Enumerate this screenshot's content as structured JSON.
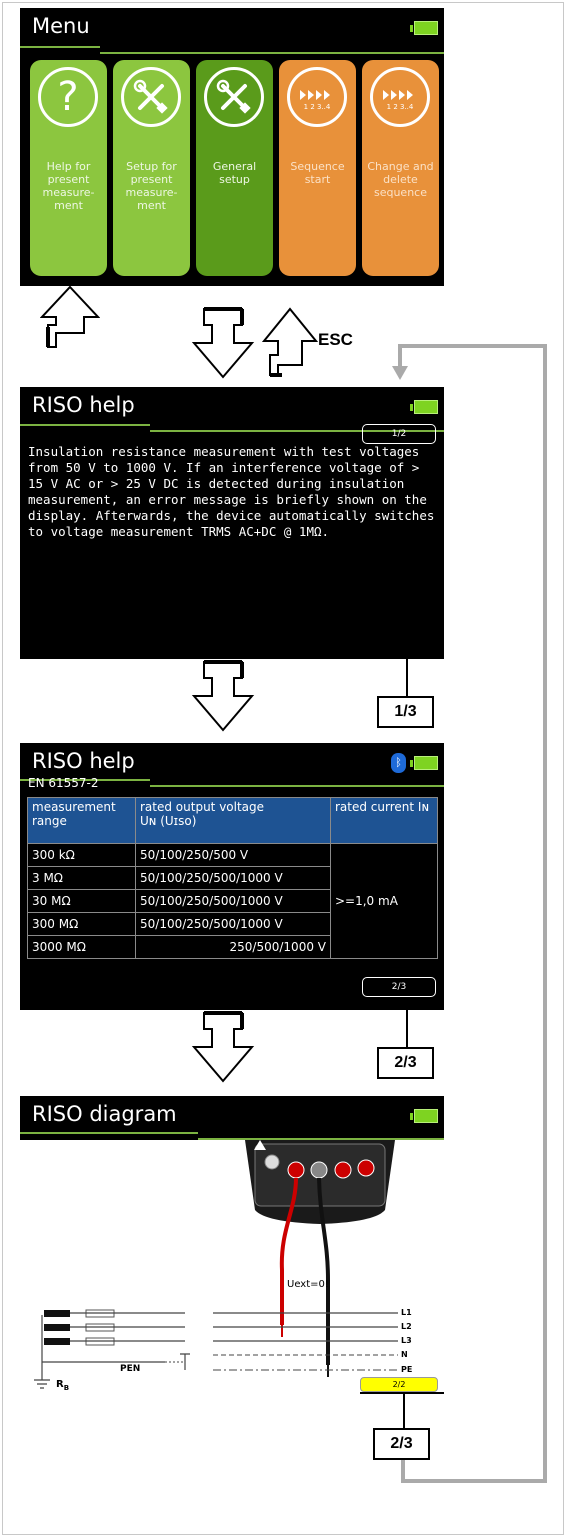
{
  "menu": {
    "title": "Menu",
    "tiles": [
      {
        "icon": "question-mark-icon",
        "glyph": "?",
        "label": "Help for present measure-ment"
      },
      {
        "icon": "tools-icon",
        "glyph": "",
        "label": "Setup for present measure-ment"
      },
      {
        "icon": "tools-icon",
        "glyph": "",
        "label": "General setup"
      },
      {
        "icon": "sequence-icon",
        "glyph": "",
        "label": "Sequence start"
      },
      {
        "icon": "sequence-icon",
        "glyph": "",
        "label": "Change and delete sequence"
      }
    ],
    "seq_numbers": "1 2 3..4"
  },
  "nav": {
    "esc_label": "ESC"
  },
  "help1": {
    "title": "RISO help",
    "text": "Insulation resistance measurement with test voltages from 50 V to 1000 V. If an interference voltage  of > 15 V AC or > 25 V DC is detected during insulation measurement, an error message is briefly shown on the display. Afterwards, the device automatically switches to voltage measurement TRMS AC+DC @ 1MΩ.",
    "page_indicator": "1/2",
    "page_box": "1/3"
  },
  "help2": {
    "title": "RISO help",
    "subtitle": "EN 61557-2",
    "headers": [
      "measurement range",
      "rated output voltage",
      "Uɴ (Uɪsᴏ)",
      "rated current Iɴ"
    ],
    "rows": [
      [
        "300 kΩ",
        "50/100/250/500 V"
      ],
      [
        "3 MΩ",
        "50/100/250/500/1000 V"
      ],
      [
        "30 MΩ",
        "50/100/250/500/1000 V"
      ],
      [
        "300 MΩ",
        "50/100/250/500/1000 V"
      ],
      [
        "3000 MΩ",
        "250/500/1000 V"
      ]
    ],
    "current_value": ">=1,0 mA",
    "page_indicator": "2/3",
    "page_box": "2/3"
  },
  "diagram": {
    "title": "RISO diagram",
    "uext_label": "Uext=0!",
    "lines": [
      "L1",
      "L2",
      "L3",
      "N",
      "PE"
    ],
    "pen_label": "PEN",
    "rb_label": "R",
    "rb_sub": "B",
    "page_indicator": "2/2",
    "page_box": "2/3"
  },
  "colors": {
    "accent_green": "#7cb342",
    "tile_light_green": "#8cc63f",
    "tile_dark_green": "#5a9b1b",
    "tile_orange": "#e8913a",
    "table_header_blue": "#1e5393",
    "page_yellow": "#ffff00"
  }
}
